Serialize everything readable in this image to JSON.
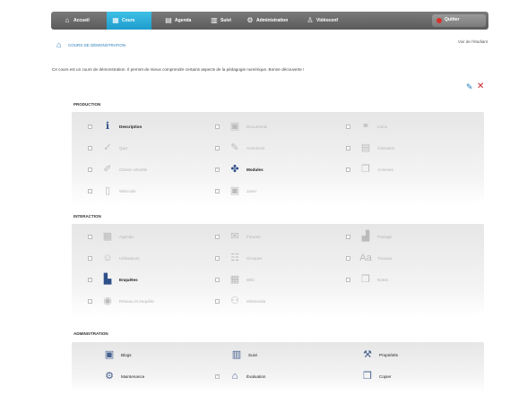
{
  "nav": {
    "items": [
      {
        "label": "Accueil",
        "icon": "home-icon",
        "glyph": "⌂"
      },
      {
        "label": "Cours",
        "icon": "courses-icon",
        "glyph": "▦",
        "active": true
      },
      {
        "label": "Agenda",
        "icon": "calendar-icon",
        "glyph": "▤"
      },
      {
        "label": "Suivi",
        "icon": "chart-icon",
        "glyph": "▥"
      },
      {
        "label": "Administration",
        "icon": "gear-icon",
        "glyph": "⚙"
      },
      {
        "label": "Vidéoconf",
        "icon": "person-icon",
        "glyph": "♙"
      }
    ],
    "quit_label": "Quitter"
  },
  "breadcrumb": "Cours de démonstration",
  "user_view": "Voir de l'étudiant",
  "intro": "Ce cours est un cours de démonstration. Il permet de mieux comprendre certains aspects de la pédagogie numérique. Bonne découverte !",
  "sections": {
    "production": "Production",
    "interaction": "Interaction",
    "administration": "Administration"
  },
  "production": [
    {
      "label": "Description",
      "glyph": "ℹ",
      "icon": "info-icon",
      "on": true
    },
    {
      "label": "Documents",
      "glyph": "▣",
      "icon": "documents-icon",
      "on": false
    },
    {
      "label": "Liens",
      "glyph": "⚭",
      "icon": "links-icon",
      "on": false
    },
    {
      "label": "Quiz",
      "glyph": "✓",
      "icon": "quiz-icon",
      "on": false
    },
    {
      "label": "Annonces",
      "glyph": "✎",
      "icon": "announcements-icon",
      "on": false
    },
    {
      "label": "Glossaire",
      "glyph": "▤",
      "icon": "glossary-icon",
      "on": false
    },
    {
      "label": "Classe virtuelle",
      "glyph": "✐",
      "icon": "virtual-class-icon",
      "on": false
    },
    {
      "label": "Modules",
      "glyph": "✤",
      "icon": "modules-icon",
      "on": true
    },
    {
      "label": "Annexes",
      "glyph": "❐",
      "icon": "annexes-icon",
      "on": false
    },
    {
      "label": "Wikicode",
      "glyph": "▯",
      "icon": "wiki-icon",
      "on": false
    },
    {
      "label": "Jaser",
      "glyph": "▣",
      "icon": "chat-icon",
      "on": false
    }
  ],
  "interaction": [
    {
      "label": "Agenda",
      "glyph": "▦",
      "icon": "calendar-icon",
      "on": false
    },
    {
      "label": "Forums",
      "glyph": "✉",
      "icon": "forums-icon",
      "on": false
    },
    {
      "label": "Partage",
      "glyph": "▟",
      "icon": "share-icon",
      "on": false
    },
    {
      "label": "Utilisateurs",
      "glyph": "☺",
      "icon": "users-icon",
      "on": false
    },
    {
      "label": "Groupes",
      "glyph": "☷",
      "icon": "groups-icon",
      "on": false
    },
    {
      "label": "Travaux",
      "glyph": "Aa",
      "icon": "assignments-icon",
      "on": false
    },
    {
      "label": "Enquêtes",
      "glyph": "▙",
      "icon": "surveys-icon",
      "on": true
    },
    {
      "label": "Wiki",
      "glyph": "▦",
      "icon": "wiki2-icon",
      "on": false
    },
    {
      "label": "Notes",
      "glyph": "❒",
      "icon": "notes-icon",
      "on": false
    },
    {
      "label": "Réseau et enquête",
      "glyph": "◉",
      "icon": "network-icon",
      "on": false
    },
    {
      "label": "Wikimedia",
      "glyph": "⚇",
      "icon": "wikimedia-icon",
      "on": false
    }
  ],
  "administration": [
    {
      "label": "Blogs",
      "glyph": "▣",
      "icon": "blogs-icon"
    },
    {
      "label": "Suivi",
      "glyph": "▥",
      "icon": "tracking-icon"
    },
    {
      "label": "Propriétés",
      "glyph": "⚒",
      "icon": "properties-icon"
    },
    {
      "label": "Maintenance",
      "glyph": "⚙",
      "icon": "maintenance-icon"
    },
    {
      "label": "Évaluation",
      "glyph": "⌂",
      "icon": "evaluation-icon"
    },
    {
      "label": "Copier",
      "glyph": "❒",
      "icon": "copy-icon"
    }
  ],
  "colors": {
    "nav_active": "#1e9ccc",
    "link": "#2a7db8",
    "delete": "#cc2222"
  }
}
